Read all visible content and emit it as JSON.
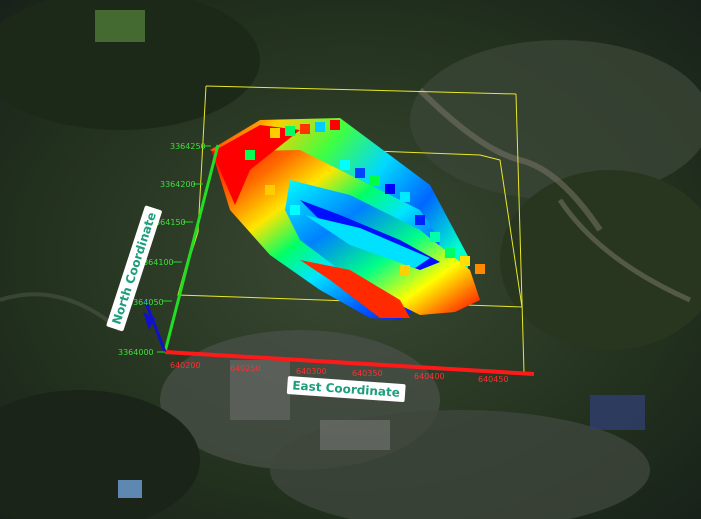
{
  "axes": {
    "x_title": "East Coordinate",
    "y_title": "North Coordinate",
    "x_ticks": [
      "640200",
      "640250",
      "640300",
      "640350",
      "640400",
      "640450"
    ],
    "y_ticks": [
      "3364000",
      "3364050",
      "3364100",
      "3364150",
      "3364200",
      "3364250"
    ],
    "x_axis_color": "#ff1a1a",
    "y_axis_color": "#22dd22",
    "z_axis_color": "#1111cc",
    "bounding_box_color": "#e8e82a",
    "x_tick_label_color": "#ff3030",
    "y_tick_label_color": "#3ce03c"
  },
  "colormap": [
    "#ff0000",
    "#ff8800",
    "#ffff00",
    "#00ff44",
    "#00ffff",
    "#0088ff",
    "#0000ff"
  ],
  "title_box_color": "#ffffff",
  "title_text_color": "#1e9e7c"
}
